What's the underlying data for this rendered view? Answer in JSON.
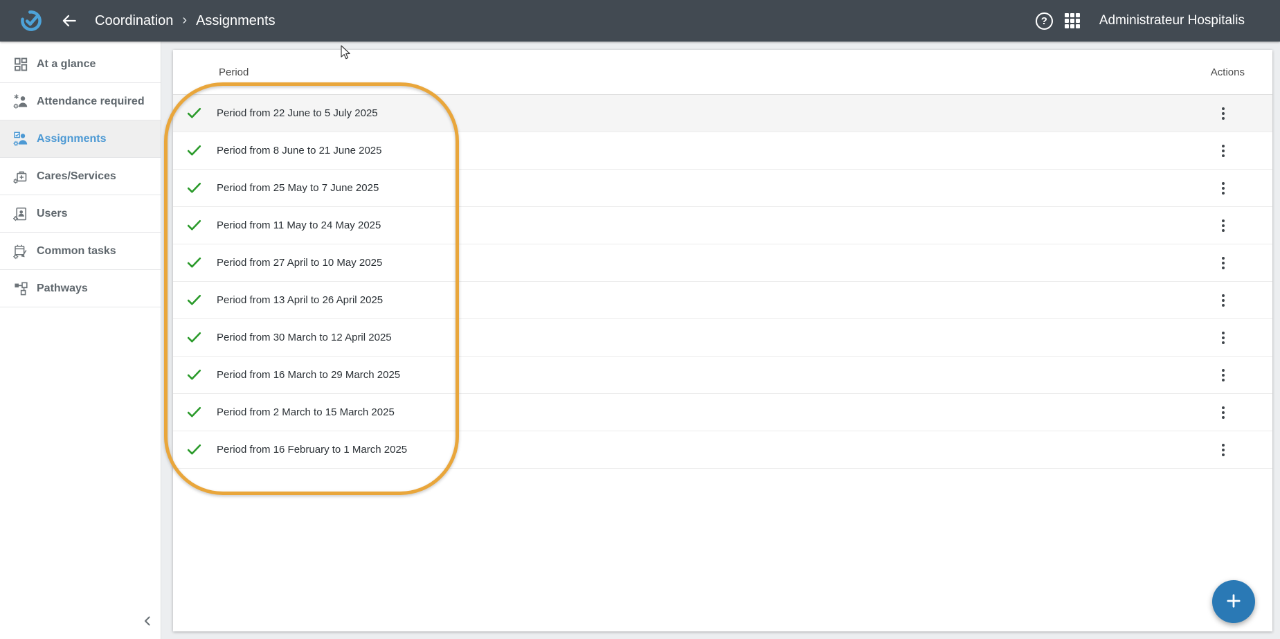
{
  "topbar": {
    "breadcrumb": {
      "items": [
        "Coordination",
        "Assignments"
      ],
      "separator": "›"
    },
    "help_glyph": "?",
    "user_name": "Administrateur Hospitalis"
  },
  "sidebar": {
    "items": [
      {
        "label": "At a glance",
        "icon": "dashboard-icon",
        "active": false
      },
      {
        "label": "Attendance required",
        "icon": "attendance-icon",
        "active": false
      },
      {
        "label": "Assignments",
        "icon": "assignments-icon",
        "active": true
      },
      {
        "label": "Cares/Services",
        "icon": "cares-icon",
        "active": false
      },
      {
        "label": "Users",
        "icon": "users-icon",
        "active": false
      },
      {
        "label": "Common tasks",
        "icon": "common-tasks-icon",
        "active": false
      },
      {
        "label": "Pathways",
        "icon": "pathways-icon",
        "active": false
      }
    ]
  },
  "table": {
    "columns": {
      "period": "Period",
      "actions": "Actions"
    },
    "rows": [
      {
        "label": "Period from 22 June to 5 July 2025",
        "status": "validated",
        "highlighted": true
      },
      {
        "label": "Period from 8 June to 21 June 2025",
        "status": "validated",
        "highlighted": false
      },
      {
        "label": "Period from 25 May to 7 June 2025",
        "status": "validated",
        "highlighted": false
      },
      {
        "label": "Period from 11 May to 24 May 2025",
        "status": "validated",
        "highlighted": false
      },
      {
        "label": "Period from 27 April to 10 May 2025",
        "status": "validated",
        "highlighted": false
      },
      {
        "label": "Period from 13 April to 26 April 2025",
        "status": "validated",
        "highlighted": false
      },
      {
        "label": "Period from 30 March to 12 April 2025",
        "status": "validated",
        "highlighted": false
      },
      {
        "label": "Period from 16 March to 29 March 2025",
        "status": "validated",
        "highlighted": false
      },
      {
        "label": "Period from 2 March to 15 March 2025",
        "status": "validated",
        "highlighted": false
      },
      {
        "label": "Period from 16 February to 1 March 2025",
        "status": "validated",
        "highlighted": false
      }
    ]
  },
  "colors": {
    "topbar_bg": "#424a52",
    "accent_blue": "#4c99d4",
    "logo_blue": "#4da3d9",
    "fab_blue": "#2a79b5",
    "check_green": "#2a9a2a",
    "annotation_orange": "#e9a63b",
    "highlight_row_bg": "#f5f5f5"
  }
}
